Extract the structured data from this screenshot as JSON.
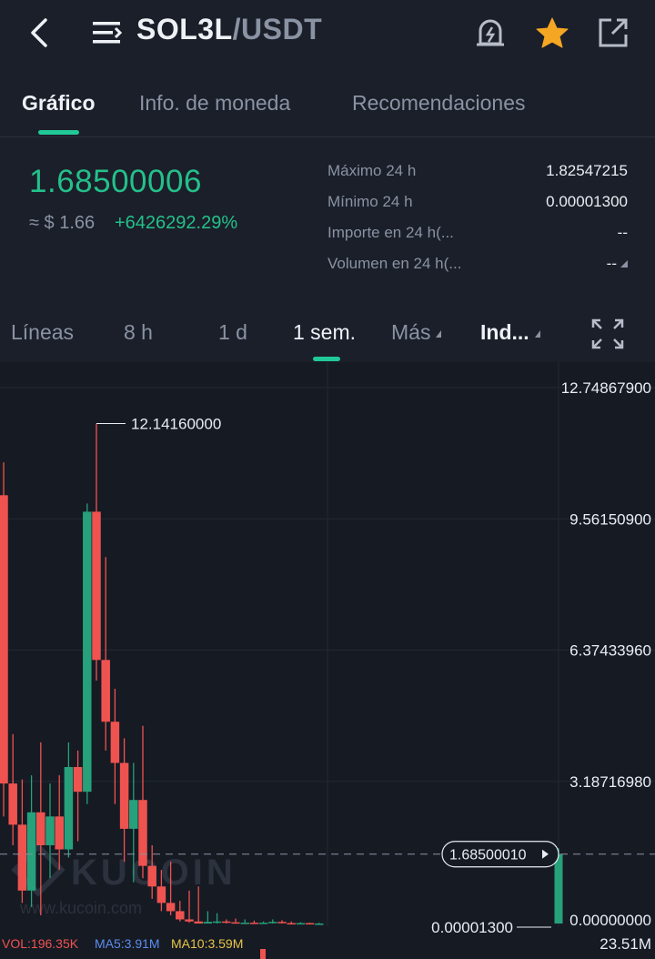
{
  "header": {
    "pair_base": "SOL3L",
    "pair_quote": "/USDT",
    "icons": [
      "back-icon",
      "menu-icon",
      "price-alert-icon",
      "favorite-star-icon",
      "share-icon"
    ]
  },
  "tabs": [
    {
      "label": "Gráfico",
      "active": true
    },
    {
      "label": "Info. de moneda",
      "active": false
    },
    {
      "label": "Recomendaciones",
      "active": false
    }
  ],
  "ticker": {
    "last_price": "1.68500006",
    "fiat_price": "≈ $ 1.66",
    "change_pct": "+6426292.29%",
    "stats": [
      {
        "label": "Máximo 24 h",
        "value": "1.82547215"
      },
      {
        "label": "Mínimo 24 h",
        "value": "0.00001300"
      },
      {
        "label": "Importe en 24 h(...",
        "value": "--"
      },
      {
        "label": "Volumen en 24 h(...",
        "value": "--"
      }
    ]
  },
  "timeframes": {
    "items": [
      "Líneas",
      "8 h",
      "1 d",
      "1 sem.",
      "Más",
      "Ind..."
    ],
    "active": "1 sem."
  },
  "chart_data": {
    "type": "candlestick",
    "y_axis_labels": [
      "12.74867900",
      "9.56150900",
      "6.37433960",
      "3.18716980",
      "0.00000000"
    ],
    "ylim": [
      0.0,
      12.748679
    ],
    "high_marker": "12.14160000",
    "low_marker": "0.00001300",
    "last_price_tag": "1.68500010",
    "volume_axis_label": "23.51M",
    "candles": [
      {
        "o": 10.4,
        "h": 11.2,
        "c": 3.4,
        "l": 2.6
      },
      {
        "o": 3.4,
        "h": 4.6,
        "c": 2.4,
        "l": 1.9
      },
      {
        "o": 2.4,
        "h": 3.5,
        "c": 0.8,
        "l": 0.5
      },
      {
        "o": 0.8,
        "h": 3.6,
        "c": 2.7,
        "l": 0.4
      },
      {
        "o": 2.7,
        "h": 4.4,
        "c": 1.9,
        "l": 0.2
      },
      {
        "o": 1.9,
        "h": 3.4,
        "c": 2.6,
        "l": 1.1
      },
      {
        "o": 2.6,
        "h": 3.6,
        "c": 1.8,
        "l": 1.3
      },
      {
        "o": 1.8,
        "h": 4.4,
        "c": 3.8,
        "l": 1.6
      },
      {
        "o": 3.8,
        "h": 4.2,
        "c": 3.2,
        "l": 2.0
      },
      {
        "o": 3.2,
        "h": 10.2,
        "c": 10.0,
        "l": 2.9
      },
      {
        "o": 10.0,
        "h": 12.1416,
        "c": 6.4,
        "l": 5.9
      },
      {
        "o": 6.4,
        "h": 8.9,
        "c": 4.9,
        "l": 4.2
      },
      {
        "o": 4.9,
        "h": 5.7,
        "c": 3.9,
        "l": 2.9
      },
      {
        "o": 3.9,
        "h": 4.5,
        "c": 2.3,
        "l": 1.5
      },
      {
        "o": 2.3,
        "h": 3.9,
        "c": 3.0,
        "l": 1.0
      },
      {
        "o": 3.0,
        "h": 4.8,
        "c": 1.4,
        "l": 1.1
      },
      {
        "o": 1.4,
        "h": 1.9,
        "c": 0.9,
        "l": 0.6
      },
      {
        "o": 0.9,
        "h": 1.3,
        "c": 0.5,
        "l": 0.3
      },
      {
        "o": 0.5,
        "h": 1.5,
        "c": 0.3,
        "l": 0.2
      },
      {
        "o": 0.3,
        "h": 0.55,
        "c": 0.1,
        "l": 0.05
      },
      {
        "o": 0.1,
        "h": 0.8,
        "c": 0.05,
        "l": 0.02
      },
      {
        "o": 0.05,
        "h": 0.9,
        "c": 0.0,
        "l": 0.0
      },
      {
        "o": 0.0,
        "h": 0.3,
        "c": 0.04,
        "l": 0.0
      },
      {
        "o": 0.04,
        "h": 0.25,
        "c": 0.05,
        "l": 0.0
      },
      {
        "o": 0.05,
        "h": 0.1,
        "c": 0.03,
        "l": 0.0
      },
      {
        "o": 0.03,
        "h": 0.12,
        "c": 0.01,
        "l": 0.0
      },
      {
        "o": 0.01,
        "h": 0.1,
        "c": 0.02,
        "l": 0.0
      },
      {
        "o": 0.02,
        "h": 0.07,
        "c": 0.01,
        "l": 0.0
      },
      {
        "o": 0.01,
        "h": 0.05,
        "c": 0.02,
        "l": 0.0
      },
      {
        "o": 0.02,
        "h": 0.1,
        "c": 0.04,
        "l": 0.0
      },
      {
        "o": 0.04,
        "h": 0.08,
        "c": 0.01,
        "l": 0.0
      },
      {
        "o": 0.01,
        "h": 0.05,
        "c": 0.0,
        "l": 0.0
      },
      {
        "o": 0.0,
        "h": 0.03,
        "c": 0.01,
        "l": 0.0
      },
      {
        "o": 0.01,
        "h": 0.02,
        "c": 0.0,
        "l": 0.0
      },
      {
        "o": 0.0,
        "h": 0.02,
        "c": 0.0,
        "l": 0.0
      }
    ],
    "last_candle": {
      "o": 1.3e-05,
      "h": 1.82547215,
      "c": 1.685,
      "l": 1.3e-05
    },
    "volume_legend": [
      {
        "label": "VOL:196.35K",
        "color": "#ef5350"
      },
      {
        "label": "MA5:3.91M",
        "color": "#5b8def"
      },
      {
        "label": "MA10:3.59M",
        "color": "#e8c547"
      }
    ],
    "watermark": "KUCOIN",
    "watermark_url": "www.kucoin.com"
  },
  "colors": {
    "up": "#26a17b",
    "down": "#ef5350",
    "accent": "#20c997"
  }
}
